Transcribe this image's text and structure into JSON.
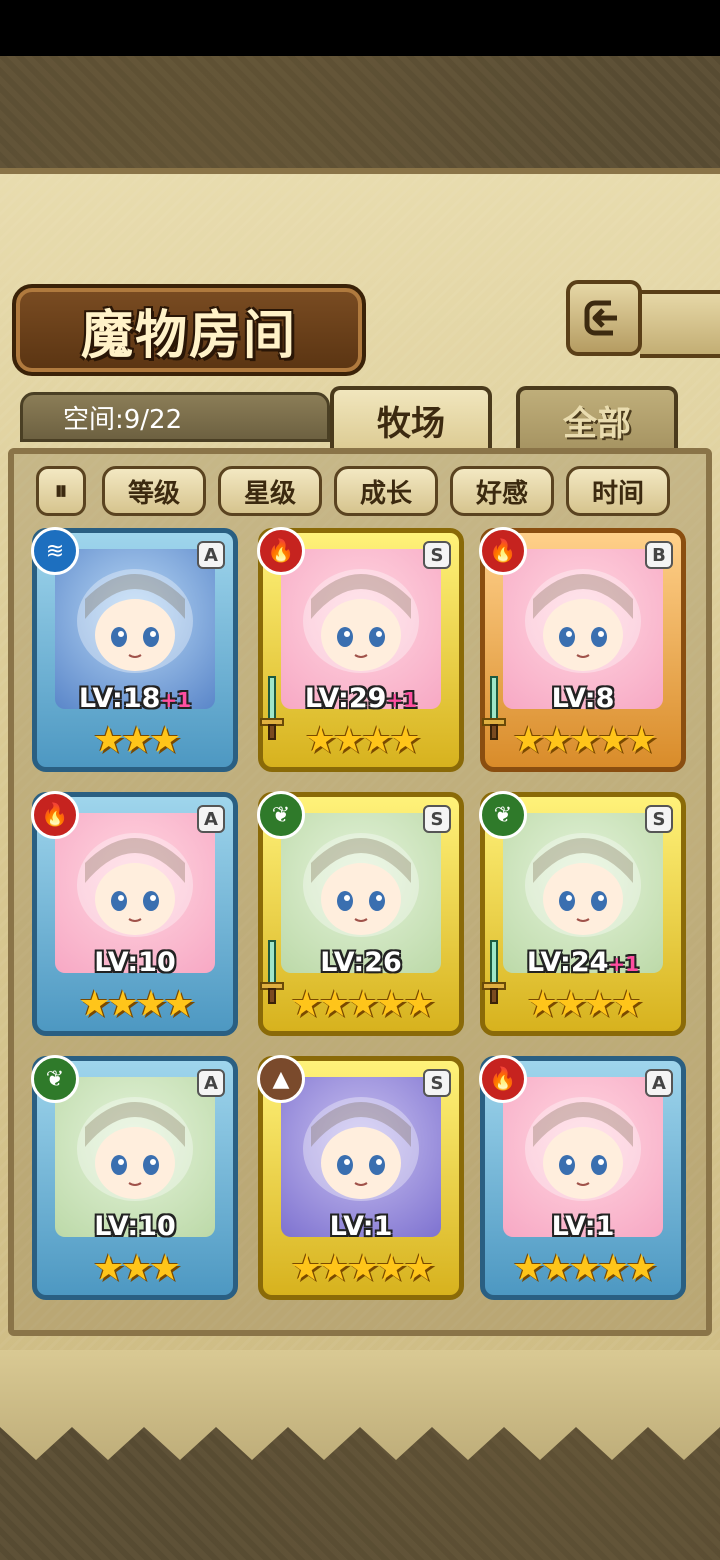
{
  "title": "魔物房间",
  "space": "空间:9/22",
  "tabs": {
    "active": "牧场",
    "inactive": "全部"
  },
  "sort": {
    "toggle_icon": "sort-toggle-icon",
    "buttons": [
      "等级",
      "星级",
      "成长",
      "好感",
      "时间"
    ]
  },
  "colors": {
    "fire": "#c6231f",
    "water": "#1d6fbf",
    "wood": "#2f7a2a",
    "earth": "#7a4a2c"
  },
  "monsters": [
    {
      "rarity": "A",
      "element": "water",
      "level": "LV:18",
      "bonus": "+1",
      "stars": 3,
      "weapon": false
    },
    {
      "rarity": "S",
      "element": "fire",
      "level": "LV:29",
      "bonus": "+1",
      "stars": 4,
      "weapon": true
    },
    {
      "rarity": "B",
      "element": "fire",
      "level": "LV:8",
      "bonus": "",
      "stars": 5,
      "weapon": true
    },
    {
      "rarity": "A",
      "element": "fire",
      "level": "LV:10",
      "bonus": "",
      "stars": 4,
      "weapon": false
    },
    {
      "rarity": "S",
      "element": "wood",
      "level": "LV:26",
      "bonus": "",
      "stars": 5,
      "weapon": true
    },
    {
      "rarity": "S",
      "element": "wood",
      "level": "LV:24",
      "bonus": "+1",
      "stars": 4,
      "weapon": true
    },
    {
      "rarity": "A",
      "element": "wood",
      "level": "LV:10",
      "bonus": "",
      "stars": 3,
      "weapon": false
    },
    {
      "rarity": "S",
      "element": "earth",
      "level": "LV:1",
      "bonus": "",
      "stars": 5,
      "weapon": false
    },
    {
      "rarity": "A",
      "element": "fire",
      "level": "LV:1",
      "bonus": "",
      "stars": 5,
      "weapon": false
    }
  ]
}
